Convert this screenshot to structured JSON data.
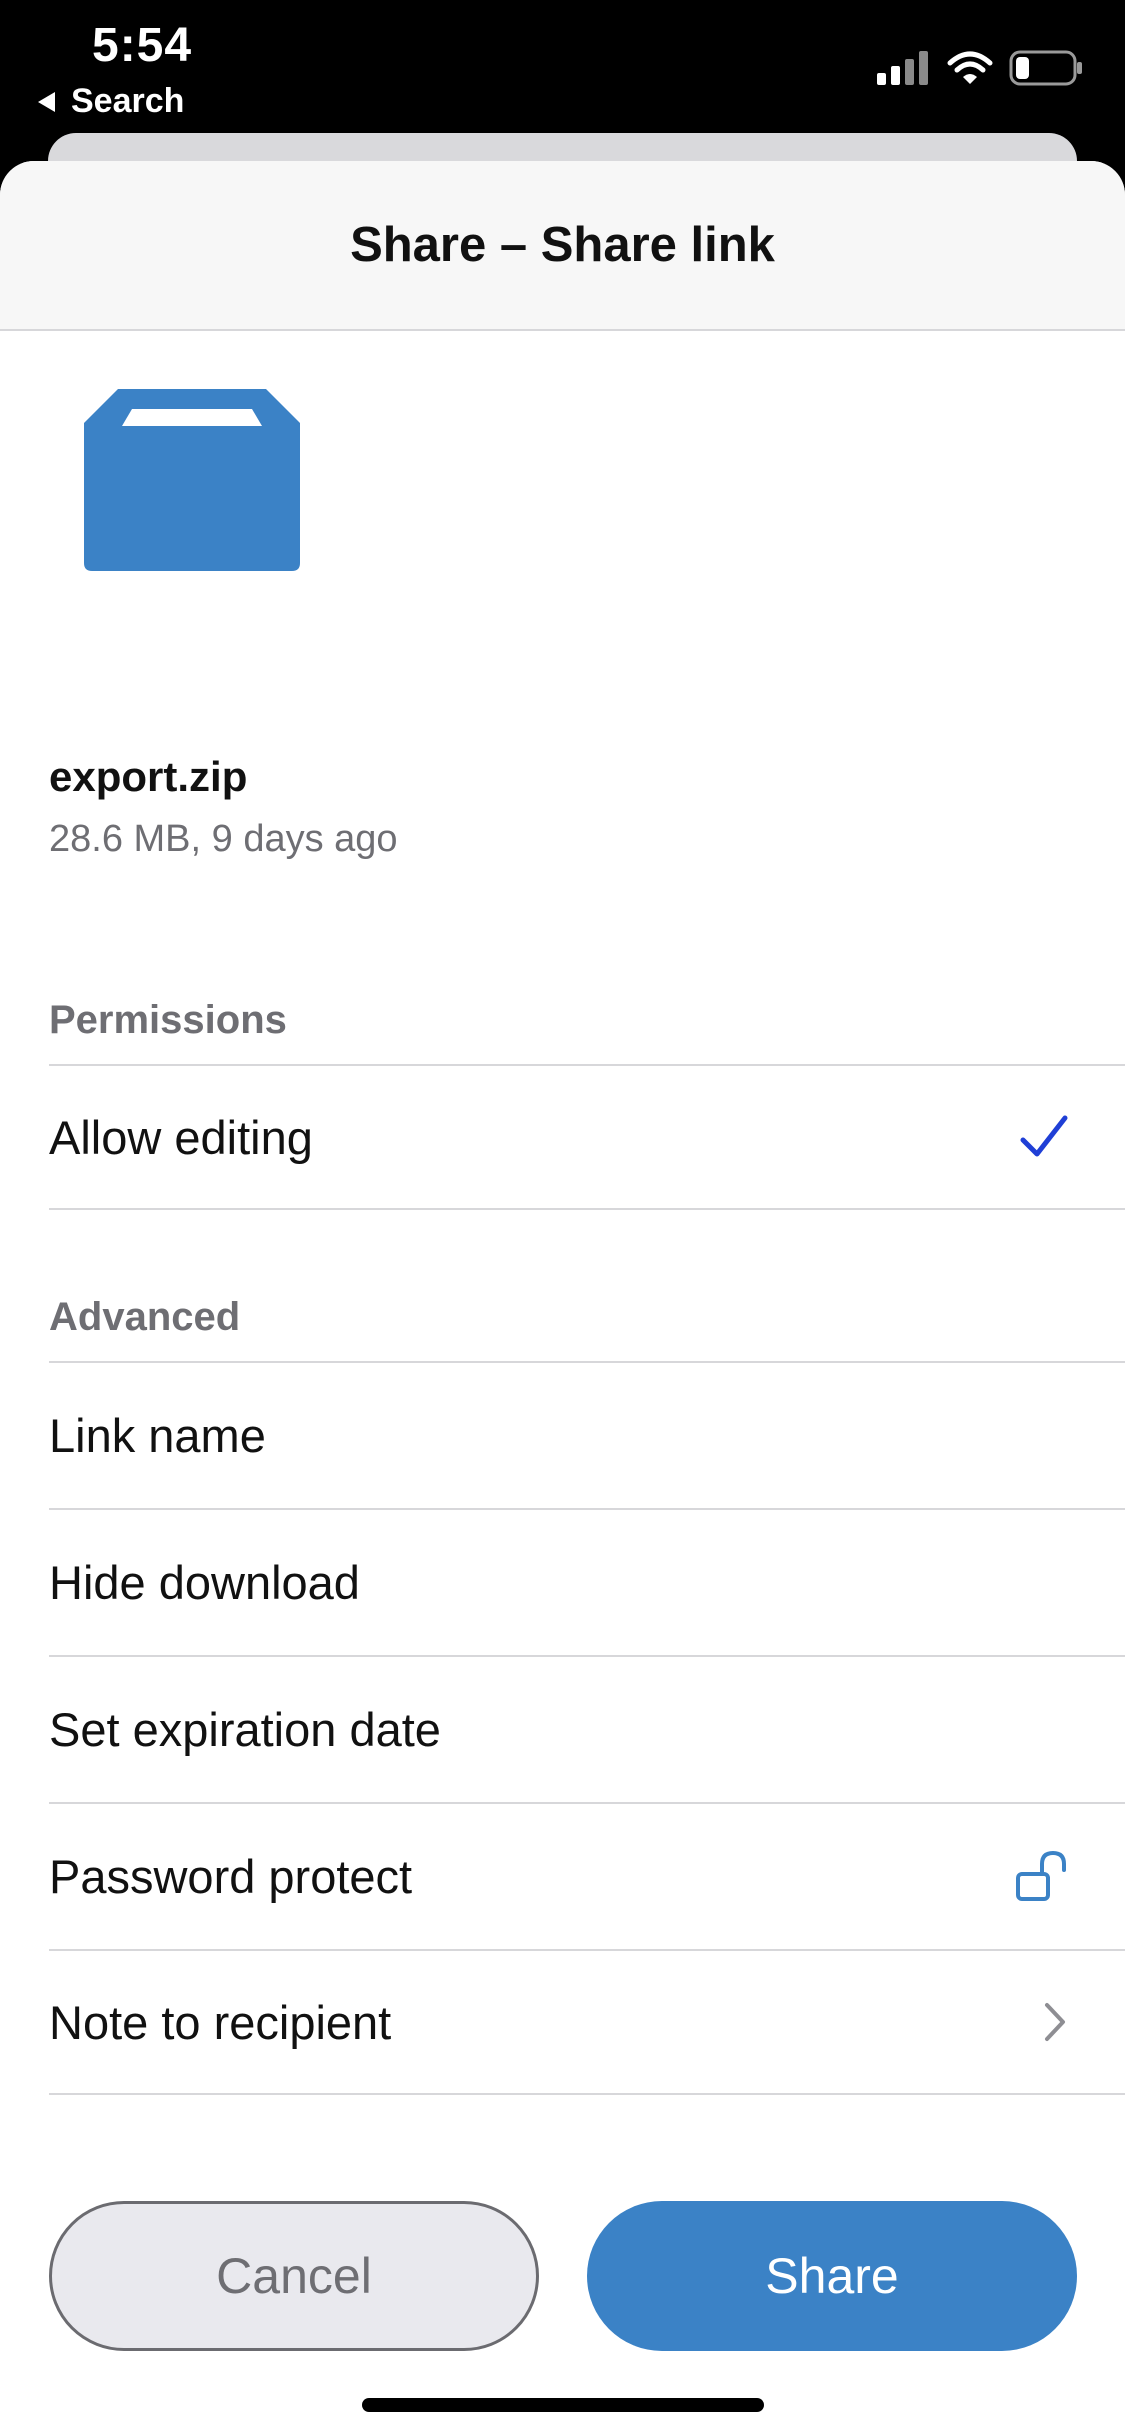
{
  "status_bar": {
    "time": "5:54",
    "back_label": "Search",
    "signal_icon": "cellular-signal-icon",
    "wifi_icon": "wifi-icon",
    "battery_icon": "battery-icon"
  },
  "sheet": {
    "title": "Share – Share link"
  },
  "file": {
    "icon": "archive-file-icon",
    "name": "export.zip",
    "meta": "28.6 MB, 9 days ago"
  },
  "permissions": {
    "header": "Permissions",
    "items": [
      {
        "label": "Allow editing",
        "checked": true,
        "icon": "checkmark-icon"
      }
    ]
  },
  "advanced": {
    "header": "Advanced",
    "items": [
      {
        "label": "Link name"
      },
      {
        "label": "Hide download"
      },
      {
        "label": "Set expiration date"
      },
      {
        "label": "Password protect",
        "icon": "unlock-icon"
      },
      {
        "label": "Note to recipient",
        "icon": "chevron-right-icon"
      }
    ]
  },
  "actions": {
    "cancel_label": "Cancel",
    "share_label": "Share"
  },
  "colors": {
    "accent": "#3b82c6",
    "check": "#1f3fd6",
    "secondary_text": "#6e6e73",
    "separator": "#d7d7da"
  }
}
